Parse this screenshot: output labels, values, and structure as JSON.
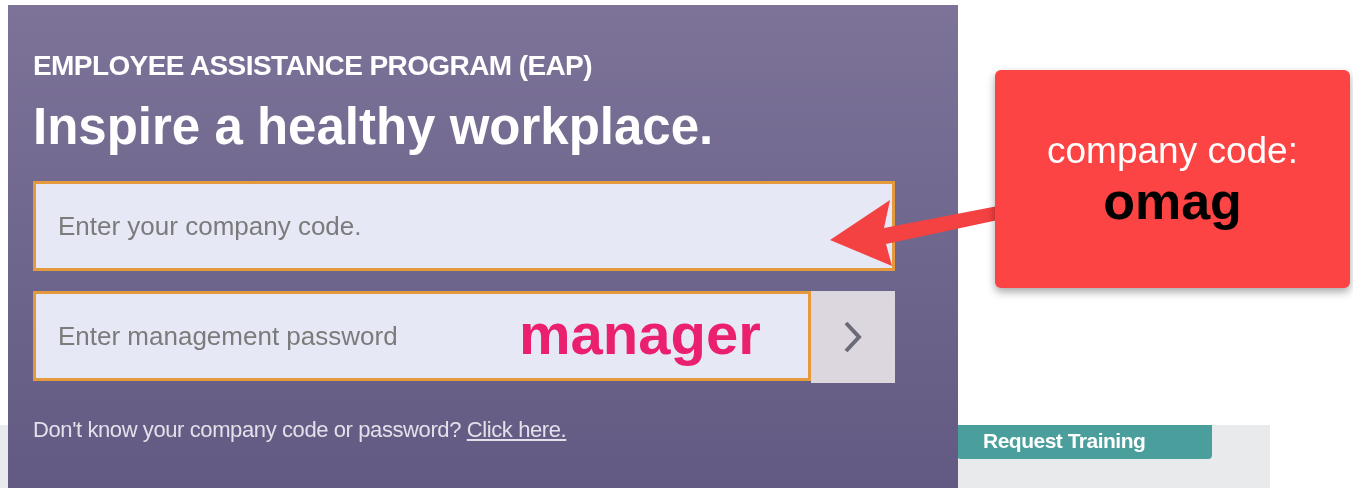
{
  "panel": {
    "eyebrow": "EMPLOYEE ASSISTANCE PROGRAM (EAP)",
    "title": "Inspire a healthy workplace.",
    "company_field": {
      "placeholder": "Enter your company code."
    },
    "password_field": {
      "placeholder": "Enter management password"
    },
    "password_annotation": "manager",
    "help_text": "Don't know your company code or password?",
    "help_link": "Click here."
  },
  "background_button": "Request Training",
  "callout": {
    "label": "company code:",
    "value": "omag"
  }
}
